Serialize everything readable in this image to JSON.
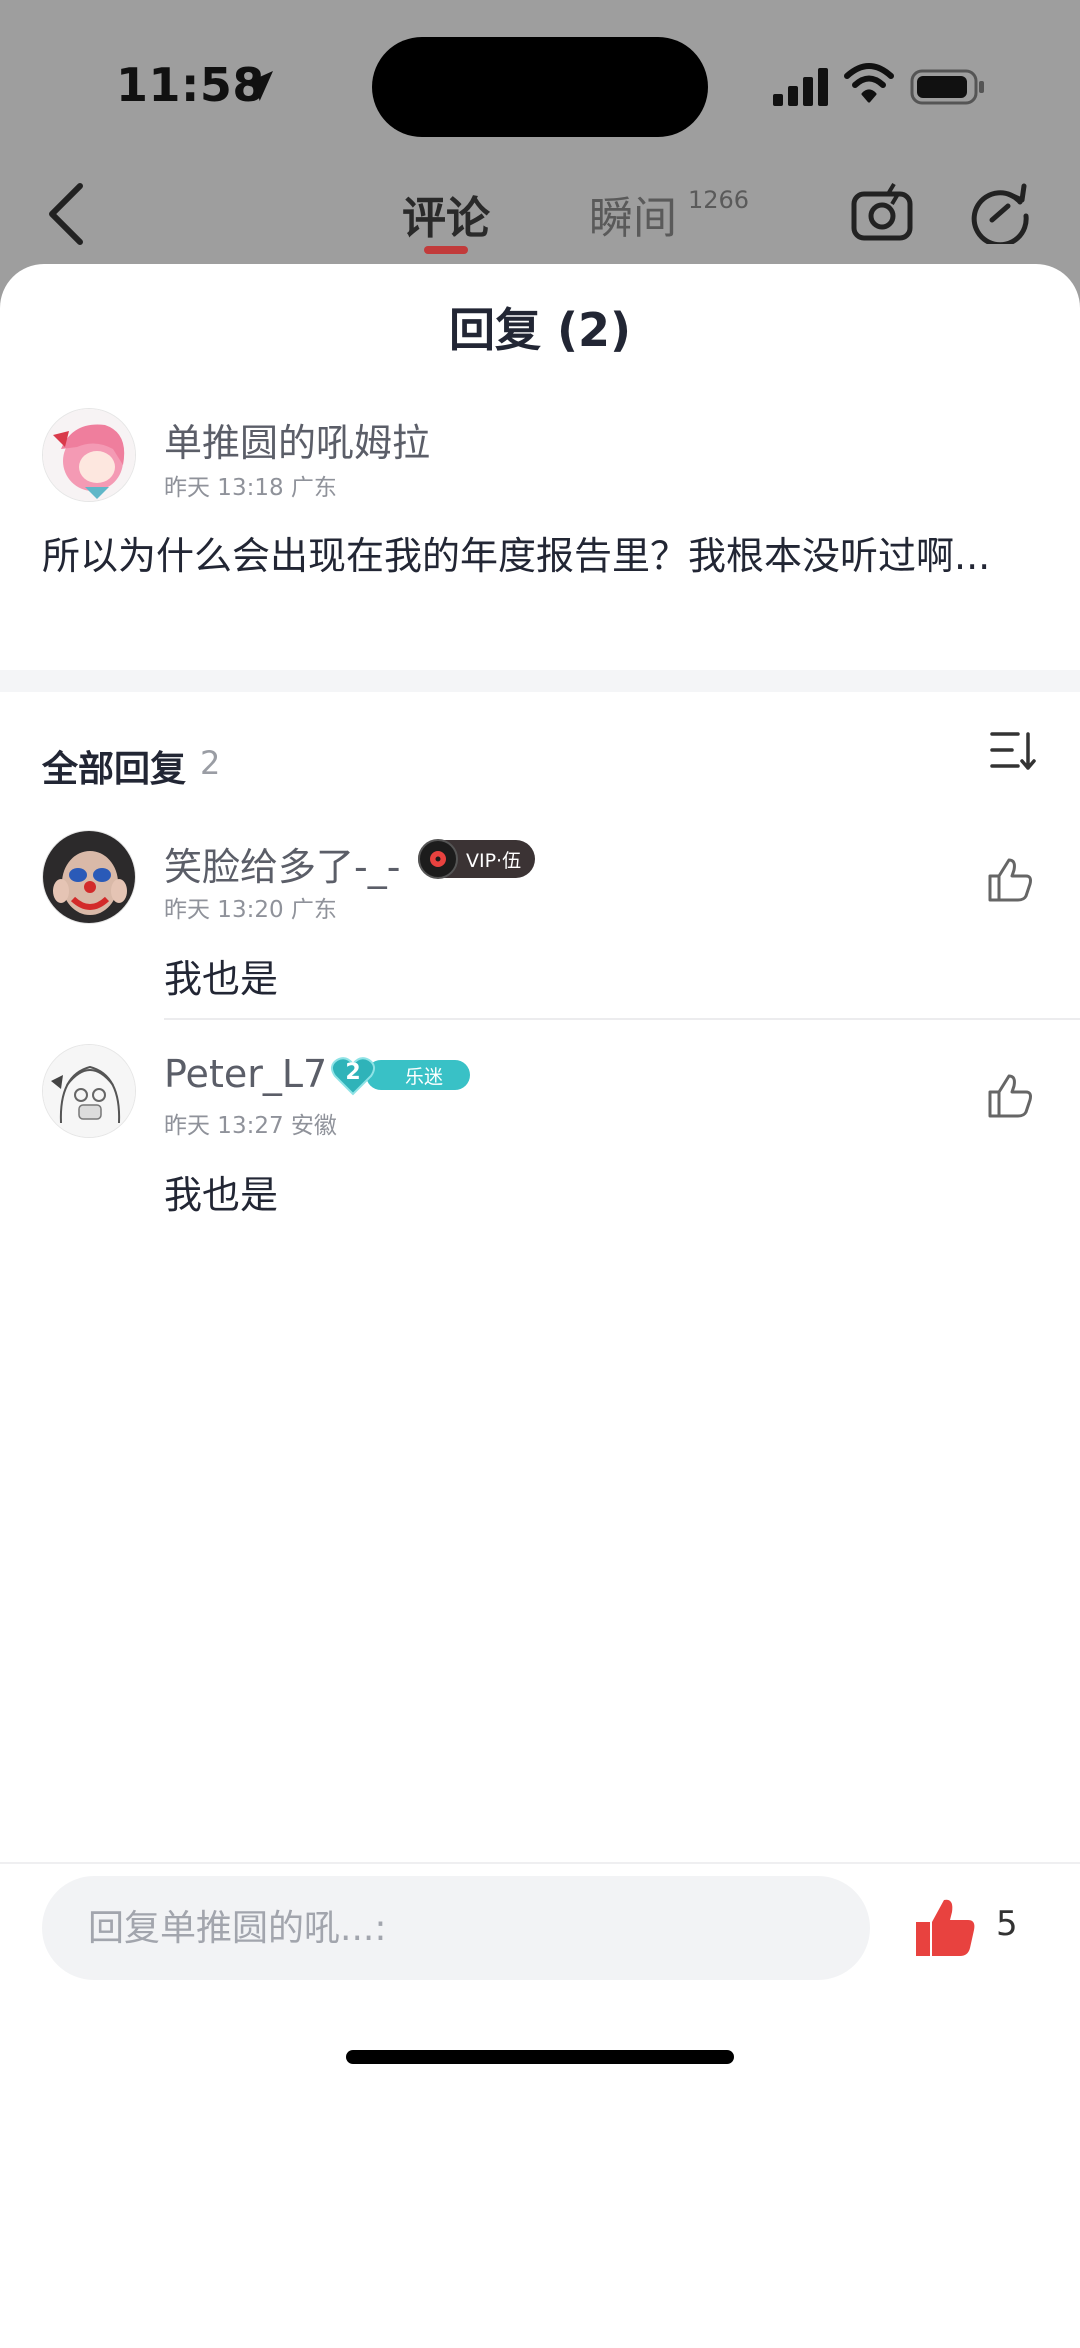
{
  "status_bar": {
    "time": "11:58"
  },
  "nav": {
    "tabs": [
      {
        "label": "评论",
        "active": true
      },
      {
        "label": "瞬间",
        "count": "1266",
        "active": false
      }
    ]
  },
  "sheet": {
    "title": "回复 (2)",
    "main_comment": {
      "username": "单推圆的吼姆拉",
      "meta": "昨天 13:18 广东",
      "text": "所以为什么会出现在我的年度报告里？我根本没听过啊..."
    },
    "replies_header": {
      "label": "全部回复",
      "count": "2"
    },
    "replies": [
      {
        "username": "笑脸给多了-_-",
        "badge": "VIP·伍",
        "meta": "昨天 13:20 广东",
        "text": "我也是"
      },
      {
        "username": "Peter_L7",
        "fan_level": "2",
        "fan_label": "乐迷",
        "meta": "昨天 13:27 安徽",
        "text": "我也是"
      }
    ]
  },
  "input_bar": {
    "placeholder": "回复单推圆的吼...:",
    "like_count": "5"
  },
  "colors": {
    "accent_red": "#e8423f",
    "tab_underline": "#c23b3b",
    "fan_teal": "#39c1c6",
    "vip_dark": "#3b3334"
  }
}
